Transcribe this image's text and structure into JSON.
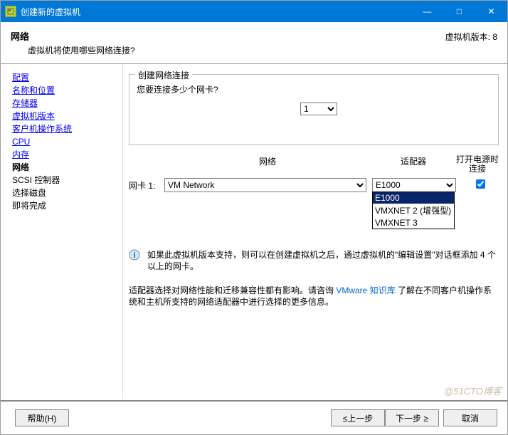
{
  "window": {
    "title": "创建新的虚拟机",
    "minimize": "—",
    "maximize": "□",
    "close": "✕"
  },
  "header": {
    "title": "网络",
    "subtitle": "虚拟机将使用哪些网络连接?",
    "version": "虚拟机版本: 8"
  },
  "sidebar": {
    "items": [
      {
        "label": "配置",
        "cls": ""
      },
      {
        "label": "名称和位置",
        "cls": ""
      },
      {
        "label": "存储器",
        "cls": ""
      },
      {
        "label": "虚拟机版本",
        "cls": ""
      },
      {
        "label": "客户机操作系统",
        "cls": ""
      },
      {
        "label": "CPU",
        "cls": ""
      },
      {
        "label": "内存",
        "cls": ""
      },
      {
        "label": "网络",
        "cls": "sel"
      },
      {
        "label": "SCSI 控制器",
        "cls": "dis"
      },
      {
        "label": "选择磁盘",
        "cls": "dis"
      },
      {
        "label": "即将完成",
        "cls": "dis"
      }
    ]
  },
  "group": {
    "legend": "创建网络连接",
    "question": "您要连接多少个网卡?",
    "nic_count": "1"
  },
  "columns": {
    "network": "网络",
    "adapter": "适配器",
    "connect": "打开电源时连接"
  },
  "row": {
    "label": "网卡 1:",
    "network_value": "VM Network",
    "adapter_value": "E1000",
    "adapter_options": [
      "E1000",
      "VMXNET 2 (增强型)",
      "VMXNET 3"
    ],
    "checked": true
  },
  "info1": "如果此虚拟机版本支持，则可以在创建虚拟机之后，通过虚拟机的\"编辑设置\"对话框添加 4 个以上的网卡。",
  "info2_a": "适配器选择对网络性能和迁移兼容性都有影响。请咨询 ",
  "info2_link": "VMware 知识库",
  "info2_b": " 了解在不同客户机操作系统和主机所支持的网络适配器中进行选择的更多信息。",
  "footer": {
    "help": "帮助(H)",
    "prev": "≤上一步",
    "next": "下一步 ≥",
    "cancel": "取消"
  },
  "watermark": "@51CTO博客"
}
